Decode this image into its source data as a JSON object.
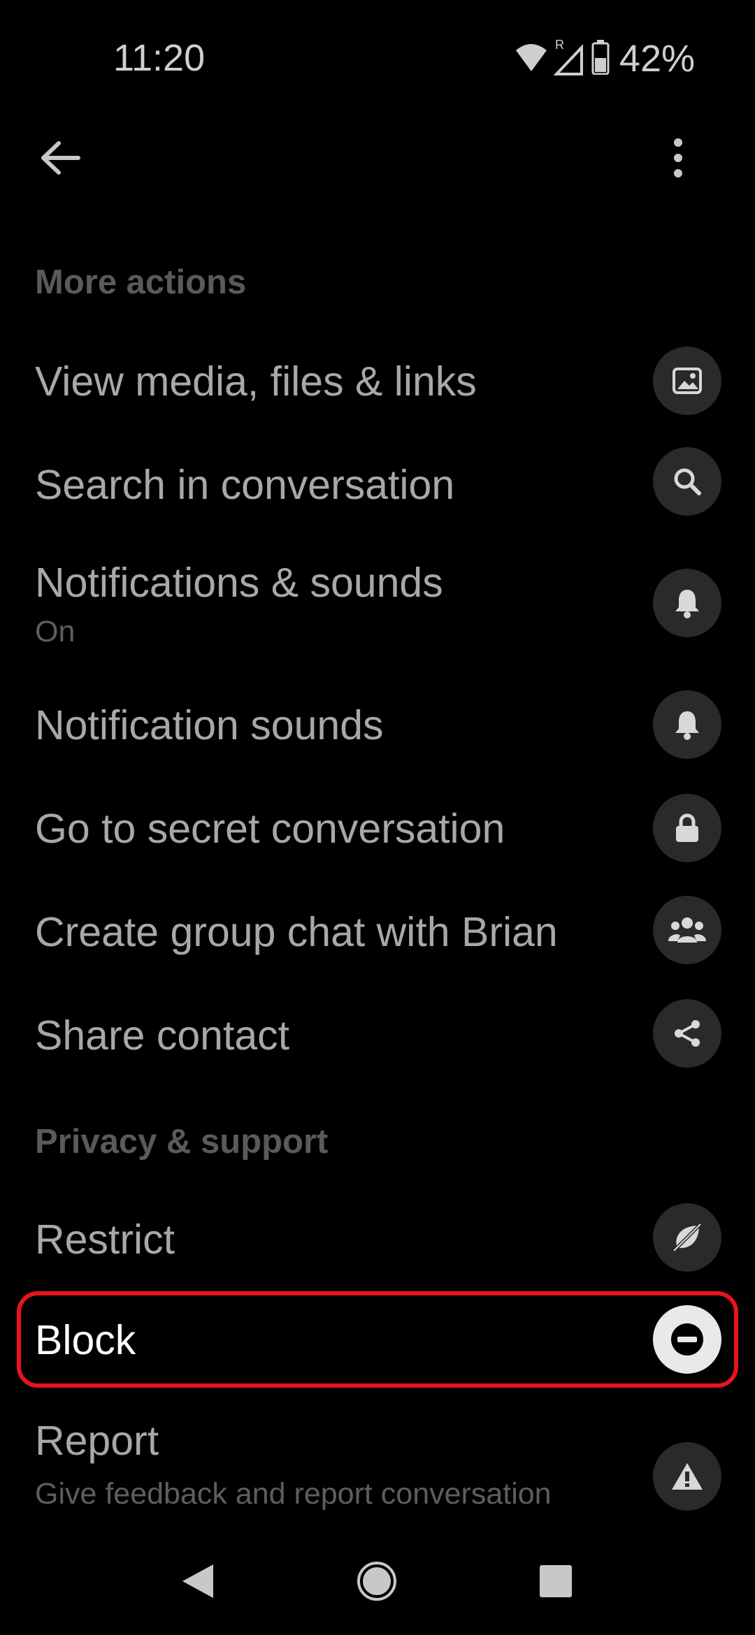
{
  "status_bar": {
    "time": "11:20",
    "battery_percent": "42%",
    "icons": [
      "wifi-icon",
      "signal-roaming-icon",
      "battery-icon"
    ]
  },
  "app_bar": {
    "back_icon": "arrow-left-icon",
    "overflow_icon": "more-vert-icon"
  },
  "sections": {
    "more_actions": "More actions",
    "privacy_support": "Privacy & support"
  },
  "rows": [
    {
      "label": "View media, files & links",
      "icon": "image-icon"
    },
    {
      "label": "Search in conversation",
      "icon": "search-icon"
    },
    {
      "label": "Notifications & sounds",
      "sub": "On",
      "icon": "bell-icon"
    },
    {
      "label": "Notification sounds",
      "icon": "bell-icon"
    },
    {
      "label": "Go to secret conversation",
      "icon": "lock-icon"
    },
    {
      "label": "Create group chat with Brian",
      "icon": "group-icon"
    },
    {
      "label": "Share contact",
      "icon": "share-icon"
    },
    {
      "label": "Restrict",
      "icon": "restrict-icon"
    },
    {
      "label": "Block",
      "icon": "block-icon",
      "highlighted": true
    },
    {
      "label": "Report",
      "sub": "Give feedback and report conversation",
      "icon": "warning-icon"
    }
  ],
  "colors": {
    "background": "#000000",
    "icon_circle": "#2a2a2a",
    "highlight_border": "#e8141c"
  },
  "nav_bar": {
    "icons": [
      "back-triangle-icon",
      "home-circle-icon",
      "recents-square-icon"
    ]
  }
}
